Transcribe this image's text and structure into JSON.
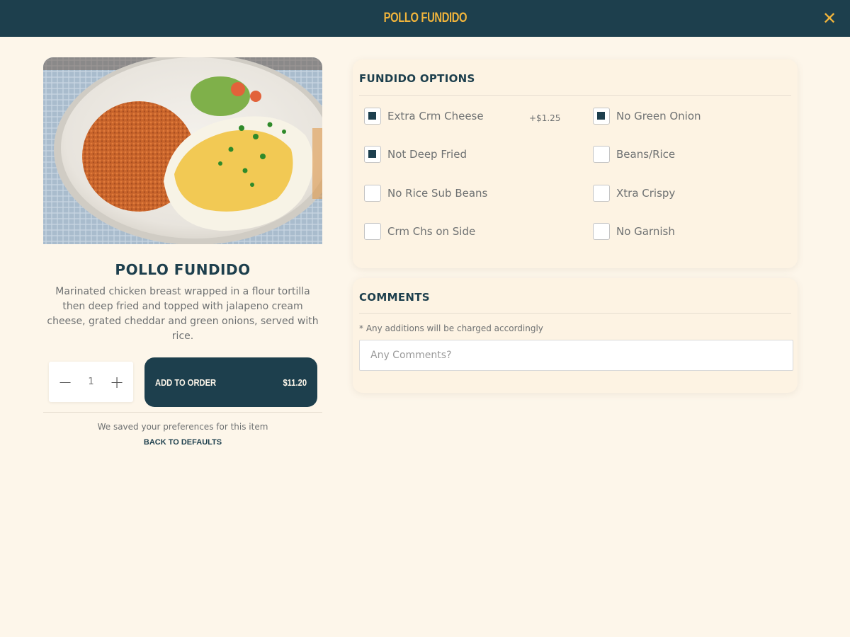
{
  "header": {
    "title": "POLLO FUNDIDO",
    "close_icon": "close-icon",
    "background": "#1d3f4d",
    "accent": "#f0b43c"
  },
  "item": {
    "image_subject": "plate with chicken burrito, rice, cheese and green onions",
    "name": "POLLO FUNDIDO",
    "description": "Marinated chicken breast wrapped in a flour tortilla then deep fried and topped with jalapeno cream cheese, grated cheddar and green onions, served with rice."
  },
  "quantity": {
    "minus_icon": "minus-icon",
    "value": "1",
    "plus_icon": "plus-icon"
  },
  "add_to_order": {
    "label": "ADD TO ORDER",
    "price": "$11.20"
  },
  "preferences": {
    "note": "We saved your preferences for this item",
    "reset_label": "BACK TO DEFAULTS"
  },
  "options": {
    "title": "FUNDIDO OPTIONS",
    "items": [
      {
        "label": "Extra Crm Cheese",
        "price": "+$1.25",
        "checked": true
      },
      {
        "label": "No Green Onion",
        "price": "",
        "checked": true
      },
      {
        "label": "Not Deep Fried",
        "price": "",
        "checked": true
      },
      {
        "label": "Beans/Rice",
        "price": "",
        "checked": false
      },
      {
        "label": "No Rice Sub Beans",
        "price": "",
        "checked": false
      },
      {
        "label": "Xtra Crispy",
        "price": "",
        "checked": false
      },
      {
        "label": "Crm Chs on Side",
        "price": "",
        "checked": false
      },
      {
        "label": "No Garnish",
        "price": "",
        "checked": false
      }
    ]
  },
  "comments": {
    "title": "COMMENTS",
    "note": "* Any additions will be charged accordingly",
    "placeholder": "Any Comments?",
    "value": ""
  },
  "colors": {
    "page_bg": "#fdf6ea",
    "primary": "#1d3f4d",
    "accent": "#f0b43c"
  }
}
